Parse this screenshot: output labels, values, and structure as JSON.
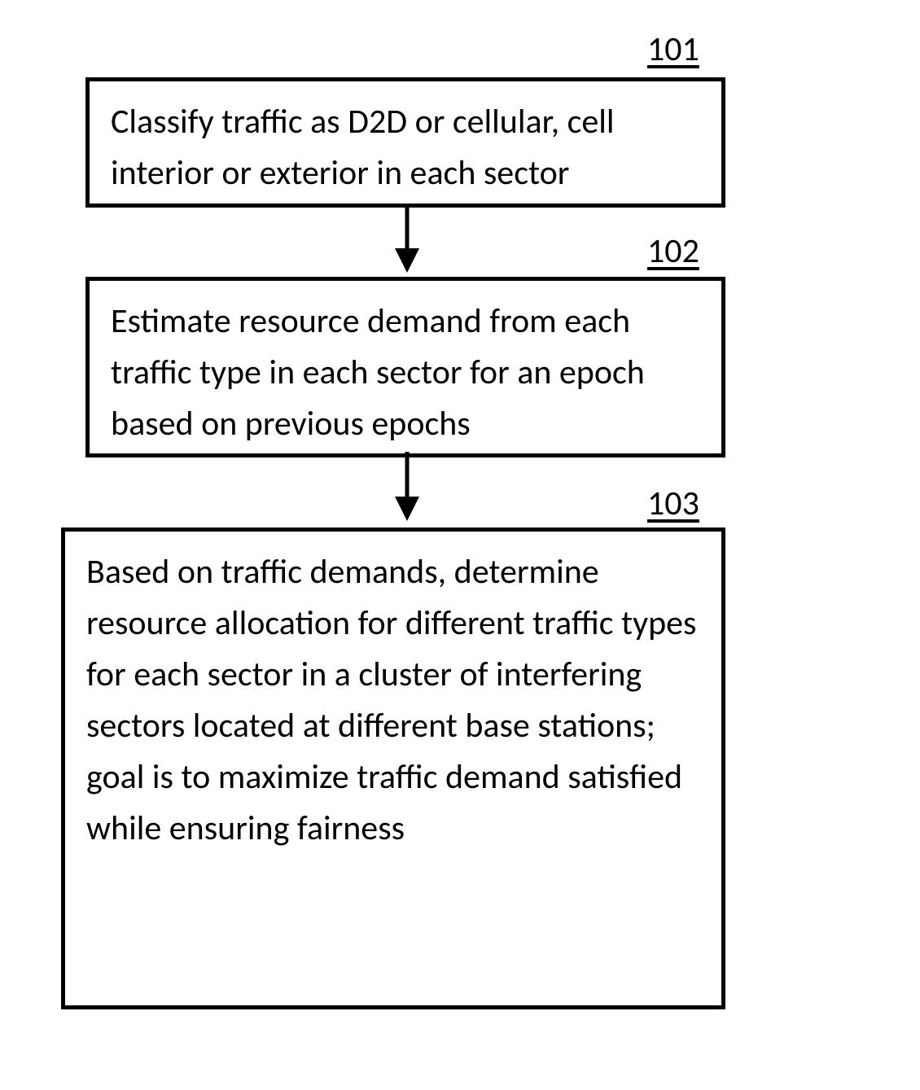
{
  "labels": {
    "step1": "101",
    "step2": "102",
    "step3": "103"
  },
  "boxes": {
    "step1": "Classify traffic as D2D or cellular, cell interior or exterior in each sector",
    "step2": "Estimate resource demand from each traffic type in each sector for an epoch based on previous epochs",
    "step3": "Based on traffic demands, determine resource allocation for different traffic types for each sector in a cluster of interfering sectors located at different base stations; goal is to maximize traffic demand satisfied while ensuring fairness"
  }
}
